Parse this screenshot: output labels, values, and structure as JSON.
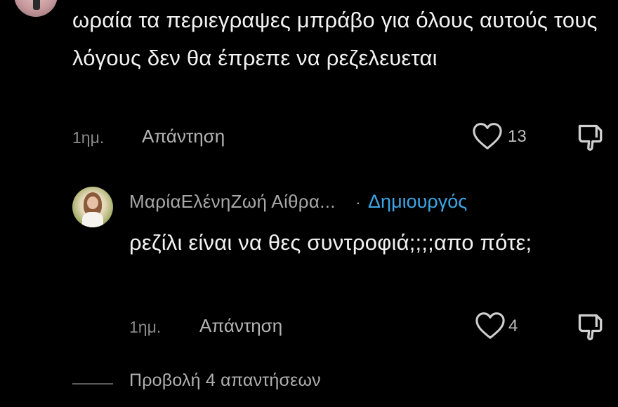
{
  "comment": {
    "text": "ωραία τα περιεγραψες μπράβο για όλους αυτούς τους λόγους δεν θα έπρεπε να ρεζελευεται",
    "time": "1ημ.",
    "reply_label": "Απάντηση",
    "like_count": "13"
  },
  "reply": {
    "author": "ΜαρίαΕλένηΖωή Αίθρα...",
    "separator": "·",
    "badge": "Δημιουργός",
    "text": "ρεζίλι είναι να θες συντροφιά;;;;απο πότε;",
    "time": "1ημ.",
    "reply_label": "Απάντηση",
    "like_count": "4"
  },
  "view_replies": "Προβολή 4 απαντήσεων",
  "colors": {
    "background": "#000000",
    "text": "#f2f2f2",
    "muted": "#8a8a8a",
    "creator_badge": "#3ea6e6"
  },
  "icons": [
    "heart-outline-icon",
    "dislike-icon"
  ]
}
